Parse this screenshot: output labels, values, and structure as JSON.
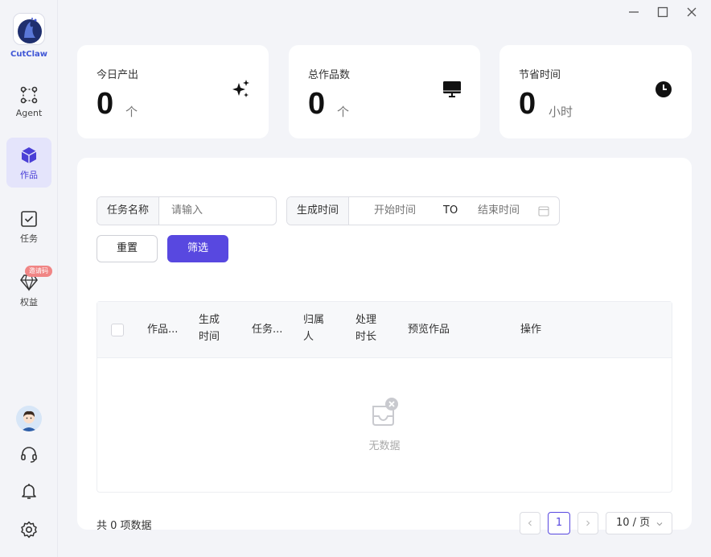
{
  "app": {
    "brand": "CutClaw"
  },
  "sidebar": {
    "items": [
      {
        "label": "Agent"
      },
      {
        "label": "作品"
      },
      {
        "label": "任务"
      },
      {
        "label": "权益",
        "badge": "邀请码"
      }
    ]
  },
  "stats": [
    {
      "title": "今日产出",
      "value": "0",
      "unit": "个"
    },
    {
      "title": "总作品数",
      "value": "0",
      "unit": "个"
    },
    {
      "title": "节省时间",
      "value": "0",
      "unit": "小时"
    }
  ],
  "filters": {
    "task_name_label": "任务名称",
    "task_name_placeholder": "请输入",
    "gen_time_label": "生成时间",
    "start_placeholder": "开始时间",
    "to_text": "TO",
    "end_placeholder": "结束时间",
    "reset_label": "重置",
    "filter_label": "筛选"
  },
  "table": {
    "headers": [
      "作品...",
      "生成\n时间",
      "任务...",
      "归属\n人",
      "处理\n时长",
      "预览作品",
      "操作"
    ],
    "empty_text": "无数据"
  },
  "pagination": {
    "total_text": "共 0 项数据",
    "current_page": "1",
    "page_size": "10 / 页"
  },
  "colors": {
    "accent": "#5848e0",
    "active_bg": "#e4e4fb",
    "badge": "#f08585"
  }
}
